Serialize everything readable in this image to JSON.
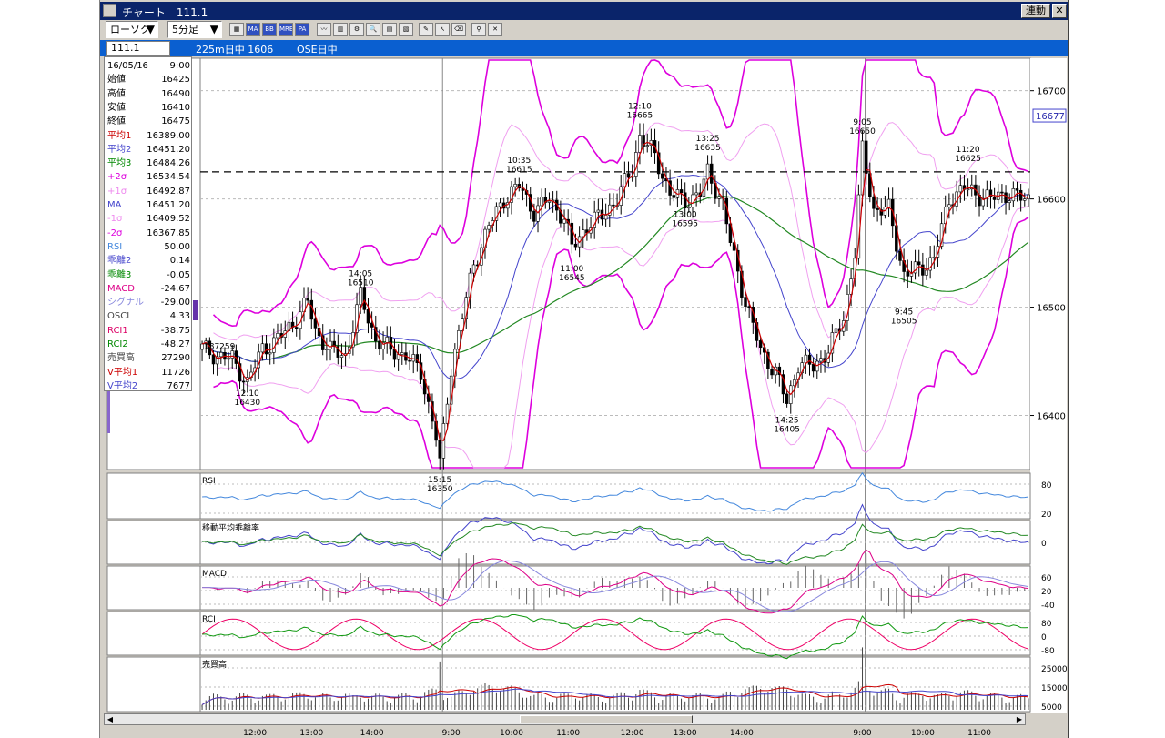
{
  "window": {
    "title": "チャート　111.1",
    "link_button": "連動",
    "close_button": "✕"
  },
  "toolbar": {
    "chart_type": "ローソク",
    "interval": "5分足",
    "buttons": [
      "MA",
      "BB",
      "MRE",
      "PA"
    ]
  },
  "symbolbar": {
    "symbol": "111.1",
    "name": "225m日中 1606",
    "market": "OSE日中"
  },
  "info": {
    "date": "16/05/16",
    "time": "9:00",
    "rows": [
      {
        "k": "始値",
        "v": "16425",
        "c": "#000000"
      },
      {
        "k": "高値",
        "v": "16490",
        "c": "#000000"
      },
      {
        "k": "安値",
        "v": "16410",
        "c": "#000000"
      },
      {
        "k": "終値",
        "v": "16475",
        "c": "#000000"
      },
      {
        "k": "平均1",
        "v": "16389.00",
        "c": "#cc0000"
      },
      {
        "k": "平均2",
        "v": "16451.20",
        "c": "#4444cc"
      },
      {
        "k": "平均3",
        "v": "16484.26",
        "c": "#008800"
      },
      {
        "k": "+2σ",
        "v": "16534.54",
        "c": "#dd00dd"
      },
      {
        "k": "+1σ",
        "v": "16492.87",
        "c": "#ee88ee"
      },
      {
        "k": "MA",
        "v": "16451.20",
        "c": "#4444cc"
      },
      {
        "k": "-1σ",
        "v": "16409.52",
        "c": "#ee88ee"
      },
      {
        "k": "-2σ",
        "v": "16367.85",
        "c": "#dd00dd"
      },
      {
        "k": "RSI",
        "v": "50.00",
        "c": "#4488dd"
      },
      {
        "k": "乖離2",
        "v": "0.14",
        "c": "#4444cc"
      },
      {
        "k": "乖離3",
        "v": "-0.05",
        "c": "#008800"
      },
      {
        "k": "MACD",
        "v": "-24.67",
        "c": "#dd0088"
      },
      {
        "k": "シグナル",
        "v": "-29.00",
        "c": "#8888dd"
      },
      {
        "k": "OSCI",
        "v": "4.33",
        "c": "#444444"
      },
      {
        "k": "RCI1",
        "v": "-38.75",
        "c": "#dd0066"
      },
      {
        "k": "RCI2",
        "v": "-48.27",
        "c": "#008800"
      },
      {
        "k": "売買高",
        "v": "27290",
        "c": "#444444"
      },
      {
        "k": "V平均1",
        "v": "11726",
        "c": "#cc0000"
      },
      {
        "k": "V平均2",
        "v": "7677",
        "c": "#4444cc"
      }
    ]
  },
  "colors": {
    "ma1": "#cc0000",
    "ma2": "#4444cc",
    "ma3": "#228822",
    "bb2": "#dd00dd",
    "bb1": "#f0a0f0",
    "rsi": "#4488dd",
    "macd": "#dd0088",
    "signal": "#8888dd",
    "rci1": "#ee0066",
    "rci2": "#119911"
  },
  "chart_data": {
    "type": "candlestick",
    "price_axis": {
      "ticks": [
        16400,
        16500,
        16600,
        16700
      ],
      "labels": [
        "16400",
        "16500",
        "16600",
        "16700"
      ],
      "range": [
        16350,
        16730
      ]
    },
    "current_price": "16677",
    "dashed_level": 16625,
    "time_labels": [
      "12:00",
      "13:00",
      "14:00",
      "9:00",
      "10:00",
      "11:00",
      "12:00",
      "13:00",
      "14:00",
      "9:00",
      "10:00",
      "11:00"
    ],
    "side_label": "187259",
    "annotations": [
      {
        "time": "12:10",
        "price": "16430",
        "at": 16430,
        "i": 12,
        "pos": "below"
      },
      {
        "time": "14:05",
        "price": "16510",
        "at": 16510,
        "i": 42,
        "pos": "above"
      },
      {
        "time": "15:15",
        "price": "16350",
        "at": 16350,
        "i": 63,
        "pos": "below"
      },
      {
        "time": "10:35",
        "price": "16615",
        "at": 16615,
        "i": 84,
        "pos": "above"
      },
      {
        "time": "11:00",
        "price": "16545",
        "at": 16545,
        "i": 98,
        "pos": "below"
      },
      {
        "time": "12:10",
        "price": "16665",
        "at": 16665,
        "i": 116,
        "pos": "above"
      },
      {
        "time": "13:00",
        "price": "16595",
        "at": 16595,
        "i": 128,
        "pos": "below"
      },
      {
        "time": "13:25",
        "price": "16635",
        "at": 16635,
        "i": 134,
        "pos": "above"
      },
      {
        "time": "14:25",
        "price": "16405",
        "at": 16405,
        "i": 155,
        "pos": "below"
      },
      {
        "time": "9:05",
        "price": "16650",
        "at": 16650,
        "i": 175,
        "pos": "above"
      },
      {
        "time": "9:45",
        "price": "16505",
        "at": 16505,
        "i": 186,
        "pos": "below"
      },
      {
        "time": "11:20",
        "price": "16625",
        "at": 16625,
        "i": 203,
        "pos": "above"
      }
    ],
    "close_path": [
      [
        0,
        16462
      ],
      [
        4,
        16455
      ],
      [
        8,
        16452
      ],
      [
        12,
        16430
      ],
      [
        16,
        16462
      ],
      [
        20,
        16470
      ],
      [
        24,
        16485
      ],
      [
        28,
        16505
      ],
      [
        30,
        16478
      ],
      [
        34,
        16460
      ],
      [
        38,
        16455
      ],
      [
        42,
        16510
      ],
      [
        46,
        16470
      ],
      [
        50,
        16460
      ],
      [
        54,
        16455
      ],
      [
        58,
        16440
      ],
      [
        62,
        16380
      ],
      [
        63,
        16355
      ],
      [
        66,
        16445
      ],
      [
        68,
        16475
      ],
      [
        72,
        16540
      ],
      [
        76,
        16575
      ],
      [
        80,
        16600
      ],
      [
        84,
        16612
      ],
      [
        88,
        16588
      ],
      [
        92,
        16600
      ],
      [
        96,
        16582
      ],
      [
        98,
        16555
      ],
      [
        102,
        16575
      ],
      [
        106,
        16585
      ],
      [
        110,
        16600
      ],
      [
        114,
        16628
      ],
      [
        116,
        16658
      ],
      [
        120,
        16640
      ],
      [
        124,
        16605
      ],
      [
        128,
        16598
      ],
      [
        132,
        16605
      ],
      [
        134,
        16625
      ],
      [
        138,
        16595
      ],
      [
        140,
        16560
      ],
      [
        144,
        16505
      ],
      [
        148,
        16460
      ],
      [
        152,
        16440
      ],
      [
        155,
        16412
      ],
      [
        158,
        16448
      ],
      [
        162,
        16445
      ],
      [
        166,
        16460
      ],
      [
        170,
        16490
      ],
      [
        173,
        16550
      ],
      [
        175,
        16645
      ],
      [
        178,
        16590
      ],
      [
        182,
        16590
      ],
      [
        186,
        16530
      ],
      [
        190,
        16535
      ],
      [
        194,
        16545
      ],
      [
        198,
        16600
      ],
      [
        202,
        16610
      ],
      [
        205,
        16605
      ],
      [
        209,
        16600
      ],
      [
        213,
        16605
      ],
      [
        218,
        16600
      ]
    ],
    "panels": [
      {
        "name": "RSI",
        "ticks": [
          "80",
          "20"
        ]
      },
      {
        "name": "移動平均乖離率",
        "ticks": [
          "0"
        ]
      },
      {
        "name": "MACD",
        "ticks": [
          "60",
          "20",
          "-40"
        ]
      },
      {
        "name": "RCI",
        "ticks": [
          "80",
          "0",
          "-80"
        ]
      },
      {
        "name": "売買高",
        "ticks": [
          "25000",
          "15000",
          "5000"
        ]
      }
    ]
  }
}
